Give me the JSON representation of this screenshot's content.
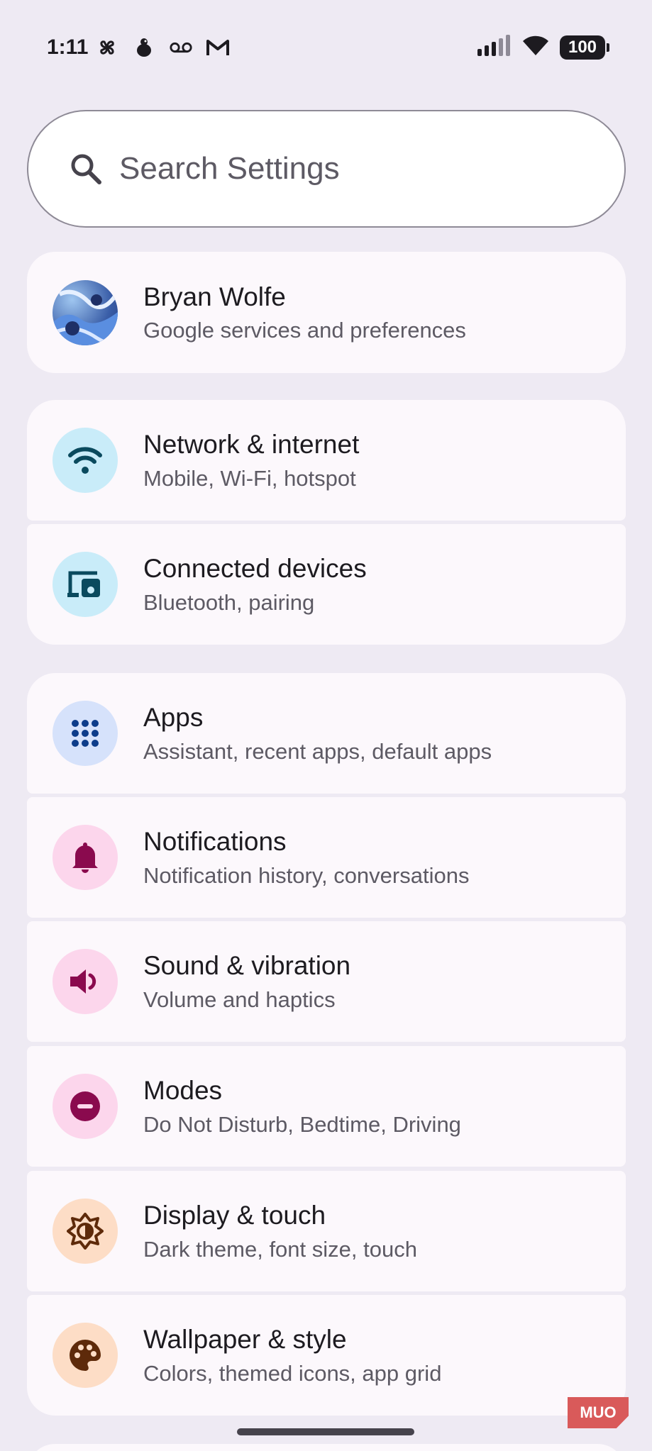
{
  "status_bar": {
    "time": "1:11",
    "battery": "100",
    "left_icons": [
      "pinwheel-icon",
      "bird-icon",
      "voicemail-icon",
      "gmail-icon"
    ],
    "right_icons": [
      "signal-icon",
      "wifi-icon",
      "battery-icon"
    ]
  },
  "search": {
    "placeholder": "Search Settings",
    "icon": "search-icon"
  },
  "account": {
    "name": "Bryan Wolfe",
    "subtitle": "Google services and preferences"
  },
  "items": [
    {
      "title": "Network & internet",
      "subtitle": "Mobile, Wi-Fi, hotspot",
      "icon": "wifi-icon",
      "color": "#c9ecf9",
      "fg": "#0a4a5e"
    },
    {
      "title": "Connected devices",
      "subtitle": "Bluetooth, pairing",
      "icon": "devices-icon",
      "color": "#c9ecf9",
      "fg": "#0a4a5e"
    },
    {
      "title": "Apps",
      "subtitle": "Assistant, recent apps, default apps",
      "icon": "apps-grid-icon",
      "color": "#d6e2fb",
      "fg": "#0d3c8a"
    },
    {
      "title": "Notifications",
      "subtitle": "Notification history, conversations",
      "icon": "bell-icon",
      "color": "#fcd6ec",
      "fg": "#8a0a4e"
    },
    {
      "title": "Sound & vibration",
      "subtitle": "Volume and haptics",
      "icon": "volume-icon",
      "color": "#fcd6ec",
      "fg": "#8a0a4e"
    },
    {
      "title": "Modes",
      "subtitle": "Do Not Disturb, Bedtime, Driving",
      "icon": "do-not-disturb-icon",
      "color": "#fcd6ec",
      "fg": "#8a0a4e"
    },
    {
      "title": "Display & touch",
      "subtitle": "Dark theme, font size, touch",
      "icon": "brightness-icon",
      "color": "#fdddc6",
      "fg": "#5e2a0a"
    },
    {
      "title": "Wallpaper & style",
      "subtitle": "Colors, themed icons, app grid",
      "icon": "palette-icon",
      "color": "#fdddc6",
      "fg": "#5e2a0a"
    }
  ],
  "watermark": "MUO"
}
